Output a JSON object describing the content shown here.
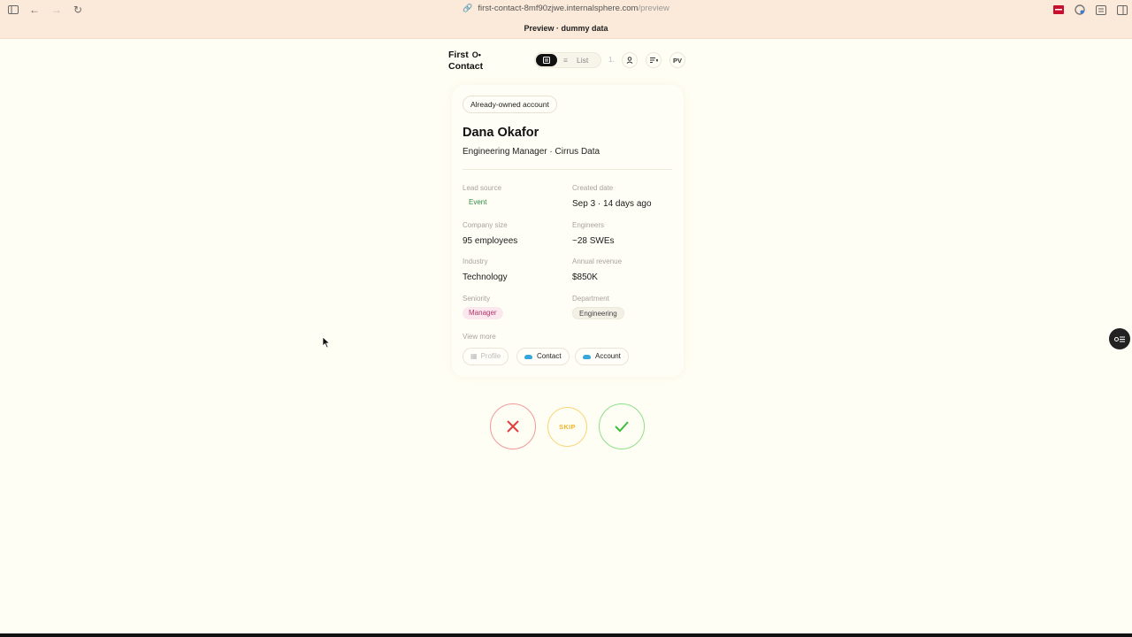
{
  "browser": {
    "url_main": "first-contact-8mf90zjwe.internalsphere.com",
    "url_path": "/preview",
    "banner": "Preview · dummy data"
  },
  "app": {
    "logo_line1": "First",
    "logo_line2": "Contact",
    "view_list_label": "List",
    "count": "1.",
    "avatar_initials": "PV"
  },
  "card": {
    "ownership_badge": "Already-owned account",
    "name": "Dana Okafor",
    "title_company": "Engineering Manager · Cirrus Data",
    "fields": {
      "lead_source_label": "Lead source",
      "lead_source_value": "Event",
      "created_label": "Created date",
      "created_value": "Sep 3 · 14 days ago",
      "company_size_label": "Company size",
      "company_size_value": "95 employees",
      "engineers_label": "Engineers",
      "engineers_value": "~28 SWEs",
      "industry_label": "Industry",
      "industry_value": "Technology",
      "revenue_label": "Annual revenue",
      "revenue_value": "$850K",
      "seniority_label": "Seniority",
      "seniority_value": "Manager",
      "department_label": "Department",
      "department_value": "Engineering"
    },
    "view_more_label": "View more",
    "links": {
      "profile": "Profile",
      "contact": "Contact",
      "account": "Account"
    }
  },
  "actions": {
    "skip_label": "SKIP"
  },
  "colors": {
    "background": "#fffef4",
    "banner": "#fbe9d9",
    "reject": "#e0403f",
    "skip": "#f0b52a",
    "accept": "#3bbf3a",
    "salesforce_blue": "#35a7dd"
  }
}
